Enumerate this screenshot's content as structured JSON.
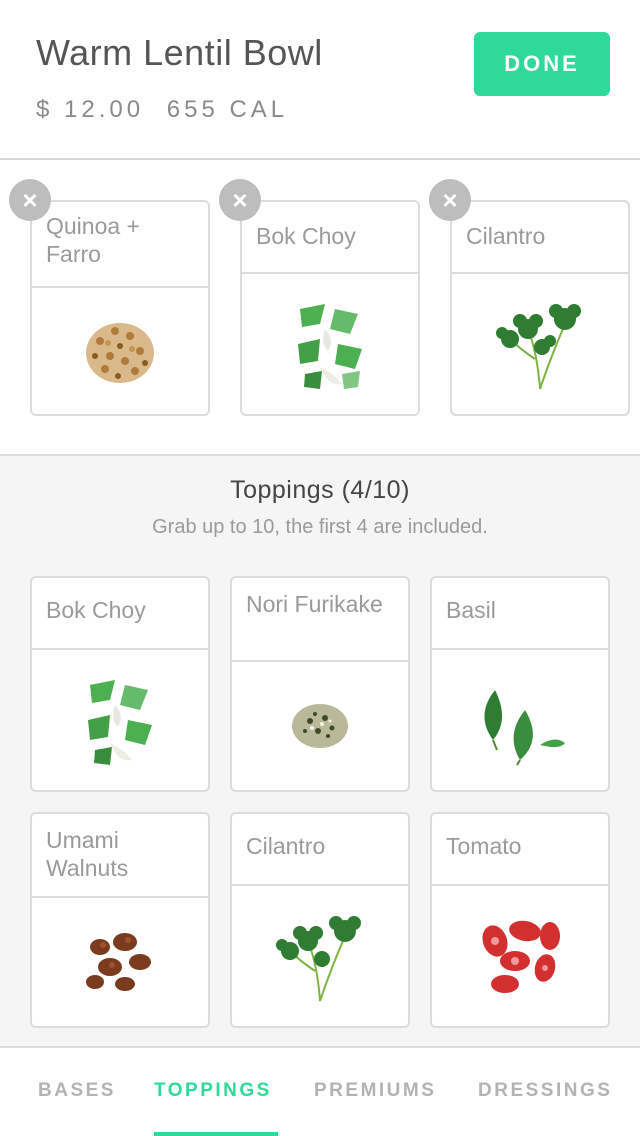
{
  "header": {
    "title": "Warm Lentil Bowl",
    "price": "$ 12.00",
    "calories": "655 CAL",
    "done_label": "DONE"
  },
  "selected": [
    {
      "label": "Quinoa + Farro",
      "icon": "grain-icon"
    },
    {
      "label": "Bok Choy",
      "icon": "bok-choy-icon"
    },
    {
      "label": "Cilantro",
      "icon": "cilantro-icon"
    }
  ],
  "toppings": {
    "title": "Toppings (4/10)",
    "subtitle": "Grab up to 10, the first 4 are included.",
    "items": [
      {
        "label": "Bok Choy"
      },
      {
        "label": "Nori Furikake"
      },
      {
        "label": "Basil"
      },
      {
        "label": "Umami Walnuts"
      },
      {
        "label": "Cilantro"
      },
      {
        "label": "Tomato"
      }
    ]
  },
  "tabs": [
    {
      "label": "BASES",
      "active": false
    },
    {
      "label": "TOPPINGS",
      "active": true
    },
    {
      "label": "PREMIUMS",
      "active": false
    },
    {
      "label": "DRESSINGS",
      "active": false
    }
  ],
  "colors": {
    "accent": "#2fd99a",
    "remove_badge": "#bdbdbd",
    "panel_bg": "#f5f5f5"
  }
}
